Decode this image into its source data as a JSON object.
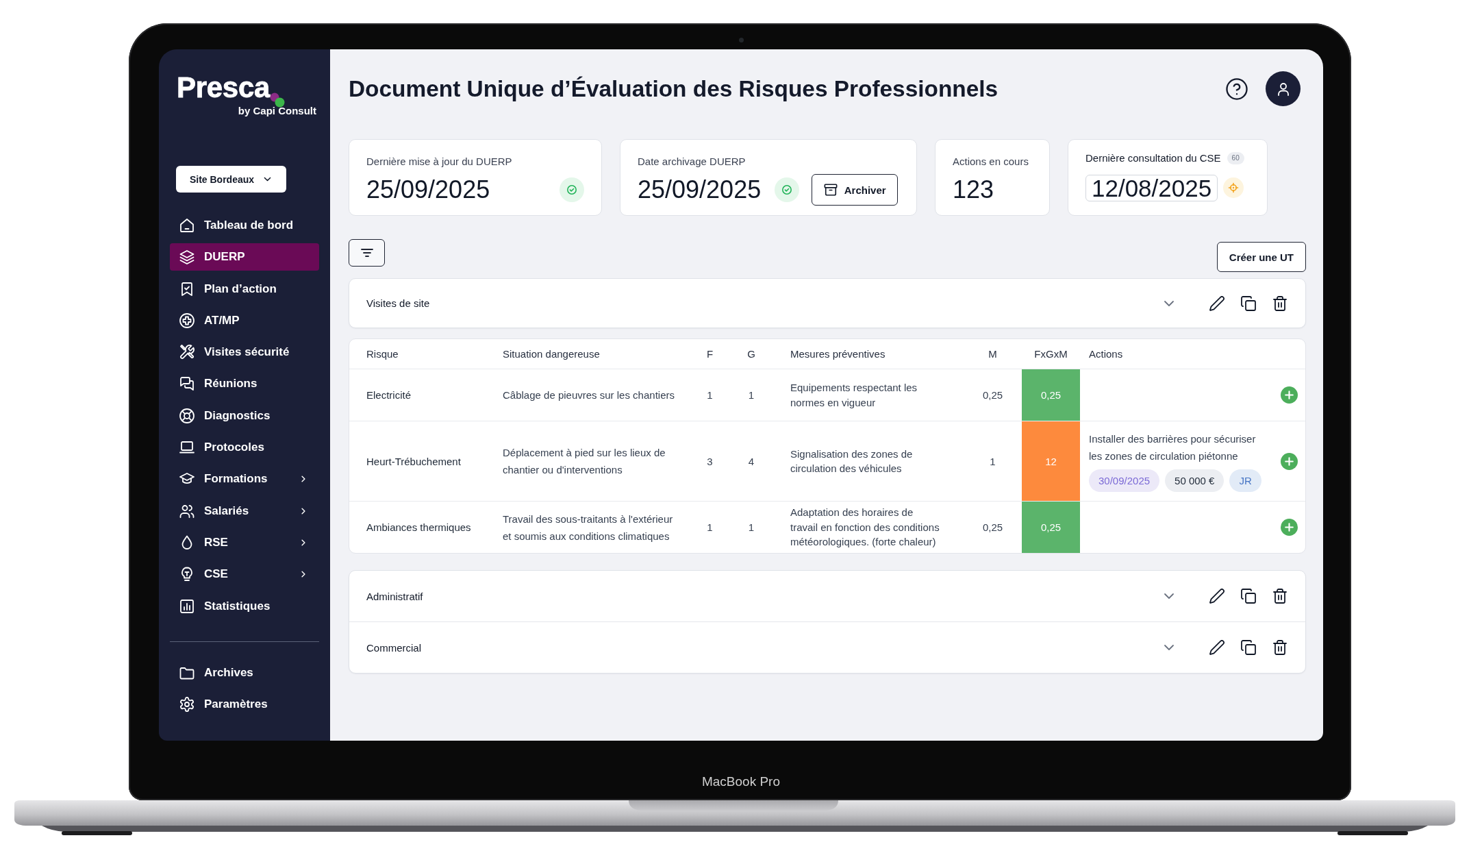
{
  "device": {
    "label": "MacBook Pro"
  },
  "sidebar": {
    "logo": "Presca",
    "tagline": "by Capi Consult",
    "site_selector": {
      "value": "Site Bordeaux"
    },
    "items": [
      {
        "label": "Tableau de bord",
        "selected": false,
        "has_submenu": false
      },
      {
        "label": "DUERP",
        "selected": true,
        "has_submenu": false
      },
      {
        "label": "Plan d’action",
        "selected": false,
        "has_submenu": false
      },
      {
        "label": "AT/MP",
        "selected": false,
        "has_submenu": false
      },
      {
        "label": "Visites sécurité",
        "selected": false,
        "has_submenu": false
      },
      {
        "label": "Réunions",
        "selected": false,
        "has_submenu": false
      },
      {
        "label": "Diagnostics",
        "selected": false,
        "has_submenu": false
      },
      {
        "label": "Protocoles",
        "selected": false,
        "has_submenu": false
      },
      {
        "label": "Formations",
        "selected": false,
        "has_submenu": true
      },
      {
        "label": "Salariés",
        "selected": false,
        "has_submenu": true
      },
      {
        "label": "RSE",
        "selected": false,
        "has_submenu": true
      },
      {
        "label": "CSE",
        "selected": false,
        "has_submenu": true
      },
      {
        "label": "Statistiques",
        "selected": false,
        "has_submenu": false
      }
    ],
    "footer_items": [
      {
        "label": "Archives",
        "selected": false
      },
      {
        "label": "Paramètres",
        "selected": false
      }
    ]
  },
  "header": {
    "title": "Document Unique d’Évaluation des Risques Professionnels"
  },
  "cards": [
    {
      "kind": "status",
      "label": "Dernière mise à jour du DUERP",
      "value": "25/09/2025"
    },
    {
      "kind": "archive",
      "label": "Date archivage DUERP",
      "value": "25/09/2025",
      "button": "Archiver"
    },
    {
      "kind": "count",
      "label": "Actions en cours",
      "value": "123"
    },
    {
      "kind": "consultation",
      "label": "Dernière consultation du CSE",
      "badge": "60",
      "value": "12/08/2025"
    }
  ],
  "toolbar": {
    "create_button": "Créer une UT"
  },
  "groups": [
    {
      "title": "Visites de site",
      "expanded": true,
      "table": {
        "columns": [
          "Risque",
          "Situation dangereuse",
          "F",
          "G",
          "Mesures préventives",
          "M",
          "FxGxM",
          "Actions"
        ],
        "rows": [
          {
            "risk": "Electricité",
            "situation": "Câblage de pieuvres sur les chantiers",
            "f": "1",
            "g": "1",
            "measures": "Equipements respectant les normes en vigueur",
            "m": "0,25",
            "score": "0,25",
            "color": "#5bb46b"
          },
          {
            "risk": "Heurt-Trébuchement",
            "situation": "Déplacement à pied sur les lieux de chantier ou d'interventions",
            "f": "3",
            "g": "4",
            "measures": "Signalisation des zones de circulation des véhicules",
            "m": "1",
            "score": "12",
            "color": "#fd8a3d",
            "action": {
              "text": "Installer des barrières pour sécuriser les zones de circulation piétonne",
              "due_date": "30/09/2025",
              "cost": "50 000 €",
              "owner": "JR"
            }
          },
          {
            "risk": "Ambiances thermiques",
            "situation": "Travail des sous-traitants à l'extérieur et soumis aux conditions climatiques",
            "f": "1",
            "g": "1",
            "measures": "Adaptation des horaires de travail en fonction des conditions météorologiques. (forte chaleur)",
            "m": "0,25",
            "score": "0,25",
            "color": "#5bb46b"
          }
        ]
      }
    },
    {
      "title": "Administratif",
      "expanded": false
    },
    {
      "title": "Commercial",
      "expanded": false
    }
  ]
}
